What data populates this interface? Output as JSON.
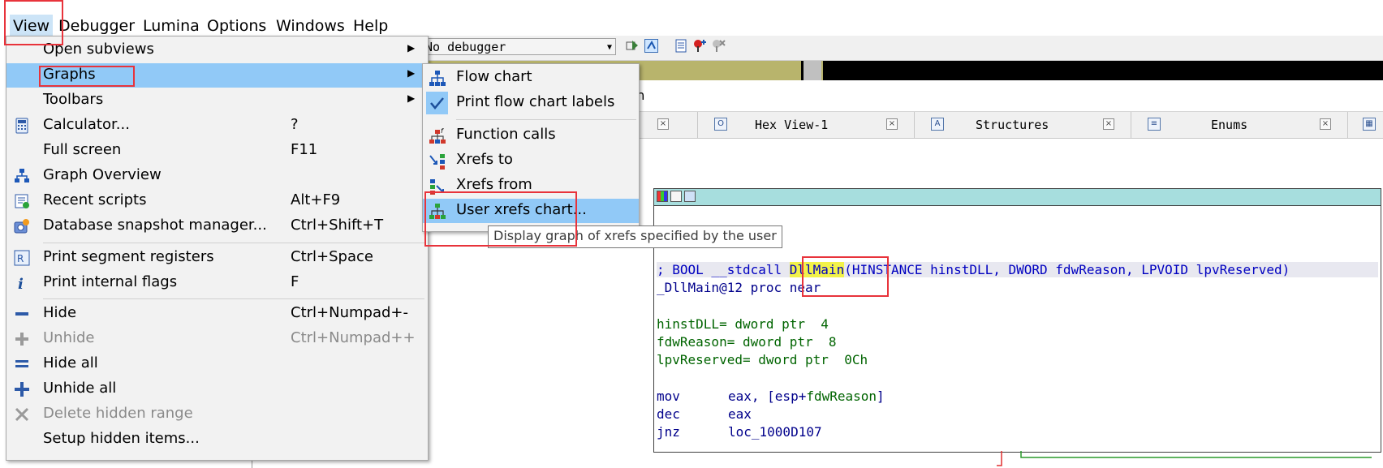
{
  "menubar": {
    "items": [
      "View",
      "Debugger",
      "Lumina",
      "Options",
      "Windows",
      "Help"
    ]
  },
  "toolbar": {
    "debugger_select": "No debugger"
  },
  "background": {
    "function_fragment": "ion"
  },
  "tabs": [
    {
      "label": "Hex View-1",
      "icon": "hex-view-icon"
    },
    {
      "label": "Structures",
      "icon": "structures-icon"
    },
    {
      "label": "Enums",
      "icon": "enums-icon"
    }
  ],
  "view_menu": {
    "items": [
      {
        "label": "Open subviews",
        "shortcut": "",
        "icon": "",
        "submenu": true
      },
      {
        "label": "Graphs",
        "shortcut": "",
        "icon": "",
        "submenu": true,
        "highlighted": true
      },
      {
        "label": "Toolbars",
        "shortcut": "",
        "icon": "",
        "submenu": true
      },
      {
        "label": "Calculator...",
        "shortcut": "?",
        "icon": "calculator-icon"
      },
      {
        "label": "Full screen",
        "shortcut": "F11",
        "icon": ""
      },
      {
        "label": "Graph Overview",
        "shortcut": "",
        "icon": "graph-overview-icon"
      },
      {
        "label": "Recent scripts",
        "shortcut": "Alt+F9",
        "icon": "recent-scripts-icon"
      },
      {
        "label": "Database snapshot manager...",
        "shortcut": "Ctrl+Shift+T",
        "icon": "snapshot-icon"
      },
      {
        "label": "Print segment registers",
        "shortcut": "Ctrl+Space",
        "icon": "segment-registers-icon"
      },
      {
        "label": "Print internal flags",
        "shortcut": "F",
        "icon": "info-icon"
      },
      {
        "label": "Hide",
        "shortcut": "Ctrl+Numpad+-",
        "icon": "minus-icon"
      },
      {
        "label": "Unhide",
        "shortcut": "Ctrl+Numpad++",
        "icon": "plus-icon",
        "disabled": true
      },
      {
        "label": "Hide all",
        "shortcut": "",
        "icon": "hide-all-icon"
      },
      {
        "label": "Unhide all",
        "shortcut": "",
        "icon": "unhide-all-icon"
      },
      {
        "label": "Delete hidden range",
        "shortcut": "",
        "icon": "delete-icon",
        "disabled": true
      },
      {
        "label": "Setup hidden items...",
        "shortcut": "",
        "icon": ""
      }
    ]
  },
  "graphs_submenu": {
    "items": [
      {
        "label": "Flow chart",
        "icon": "flow-chart-icon"
      },
      {
        "label": "Print flow chart labels",
        "icon": "check-icon",
        "checked": true
      },
      {
        "label": "Function calls",
        "icon": "function-calls-icon"
      },
      {
        "label": "Xrefs to",
        "icon": "xrefs-to-icon"
      },
      {
        "label": "Xrefs from",
        "icon": "xrefs-from-icon"
      },
      {
        "label": "User xrefs chart...",
        "icon": "user-xrefs-icon",
        "highlighted": true
      }
    ]
  },
  "tooltip": "Display graph of xrefs specified by the user",
  "disassembly": {
    "comment_prefix": "; BOOL __stdcall ",
    "function_name": "DllMain",
    "comment_suffix": "(HINSTANCE hinstDLL, DWORD fdwReason, LPVOID lpvReserved)",
    "proc_line_label": "_DllMain@12 ",
    "proc_keyword": "proc ",
    "proc_near": "near",
    "vars": [
      {
        "name": "hinstDLL",
        "def": "= dword ptr  4"
      },
      {
        "name": "fdwReason",
        "def": "= dword ptr  8"
      },
      {
        "name": "lpvReserved",
        "def": "= dword ptr  0Ch"
      }
    ],
    "instr": [
      {
        "mnemonic": "mov",
        "operands_pre": "eax, [esp+",
        "operand_var": "fdwReason",
        "operands_post": "]"
      },
      {
        "mnemonic": "dec",
        "operands_pre": "eax",
        "operand_var": "",
        "operands_post": ""
      },
      {
        "mnemonic": "jnz",
        "operands_pre": "loc_1000D107",
        "operand_var": "",
        "operands_post": ""
      }
    ]
  },
  "colors": {
    "menu_highlight": "#91c9f7",
    "annotation_red": "#e8333b",
    "name_highlight": "#f2f24a",
    "node_title": "#a7dede"
  }
}
